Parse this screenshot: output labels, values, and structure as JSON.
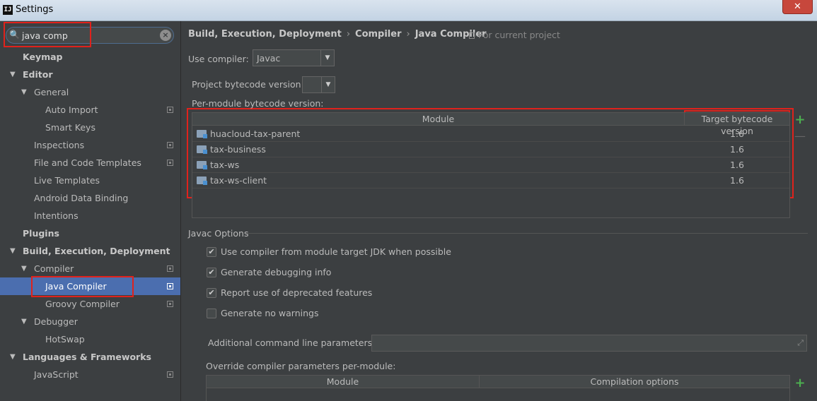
{
  "window": {
    "title": "Settings",
    "app_icon": "IJ",
    "close_label": "✕"
  },
  "search": {
    "value": "java comp",
    "icon": "search-icon",
    "clear_icon": "clear-icon"
  },
  "sidebar": {
    "items": [
      {
        "label": "Keymap",
        "level": 0,
        "bold": true,
        "arrow": "",
        "project": false
      },
      {
        "label": "Editor",
        "level": 0,
        "bold": true,
        "arrow": "▼",
        "project": false
      },
      {
        "label": "General",
        "level": 1,
        "bold": false,
        "arrow": "▼",
        "project": false
      },
      {
        "label": "Auto Import",
        "level": 2,
        "bold": false,
        "arrow": "",
        "project": true
      },
      {
        "label": "Smart Keys",
        "level": 2,
        "bold": false,
        "arrow": "",
        "project": false
      },
      {
        "label": "Inspections",
        "level": 1,
        "bold": false,
        "arrow": "",
        "project": true
      },
      {
        "label": "File and Code Templates",
        "level": 1,
        "bold": false,
        "arrow": "",
        "project": true
      },
      {
        "label": "Live Templates",
        "level": 1,
        "bold": false,
        "arrow": "",
        "project": false
      },
      {
        "label": "Android Data Binding",
        "level": 1,
        "bold": false,
        "arrow": "",
        "project": false
      },
      {
        "label": "Intentions",
        "level": 1,
        "bold": false,
        "arrow": "",
        "project": false
      },
      {
        "label": "Plugins",
        "level": 0,
        "bold": true,
        "arrow": "",
        "project": false
      },
      {
        "label": "Build, Execution, Deployment",
        "level": 0,
        "bold": true,
        "arrow": "▼",
        "project": false
      },
      {
        "label": "Compiler",
        "level": 1,
        "bold": false,
        "arrow": "▼",
        "project": true
      },
      {
        "label": "Java Compiler",
        "level": 2,
        "bold": false,
        "arrow": "",
        "project": true,
        "selected": true
      },
      {
        "label": "Groovy Compiler",
        "level": 2,
        "bold": false,
        "arrow": "",
        "project": true
      },
      {
        "label": "Debugger",
        "level": 1,
        "bold": false,
        "arrow": "▼",
        "project": false
      },
      {
        "label": "HotSwap",
        "level": 2,
        "bold": false,
        "arrow": "",
        "project": false
      },
      {
        "label": "Languages & Frameworks",
        "level": 0,
        "bold": true,
        "arrow": "▼",
        "project": false
      },
      {
        "label": "JavaScript",
        "level": 1,
        "bold": false,
        "arrow": "",
        "project": true
      }
    ]
  },
  "breadcrumb": {
    "items": [
      "Build, Execution, Deployment",
      "Compiler",
      "Java Compiler"
    ],
    "separator": "›"
  },
  "for_project": "For current project",
  "compiler": {
    "label": "Use compiler:",
    "value": "Javac"
  },
  "bytecode": {
    "label": "Project bytecode version:",
    "value": ""
  },
  "per_module": {
    "label": "Per-module bytecode version:",
    "headers": [
      "Module",
      "Target bytecode version"
    ],
    "rows": [
      {
        "module": "huacloud-tax-parent",
        "version": "1.6"
      },
      {
        "module": "tax-business",
        "version": "1.6"
      },
      {
        "module": "tax-ws",
        "version": "1.6"
      },
      {
        "module": "tax-ws-client",
        "version": "1.6"
      }
    ],
    "add_label": "+",
    "remove_label": "—"
  },
  "javac": {
    "section_title": "Javac Options",
    "options": [
      {
        "label": "Use compiler from module target JDK when possible",
        "checked": true
      },
      {
        "label": "Generate debugging info",
        "checked": true
      },
      {
        "label": "Report use of deprecated features",
        "checked": true
      },
      {
        "label": "Generate no warnings",
        "checked": false
      }
    ],
    "additional_label": "Additional command line parameters:",
    "additional_value": "",
    "override_label": "Override compiler parameters per-module:",
    "override_headers": [
      "Module",
      "Compilation options"
    ],
    "override_add": "+"
  },
  "colors": {
    "accent": "#4b6eaf",
    "highlight_box": "#e0221c",
    "add_green": "#4caf50",
    "background": "#3c3f41"
  }
}
